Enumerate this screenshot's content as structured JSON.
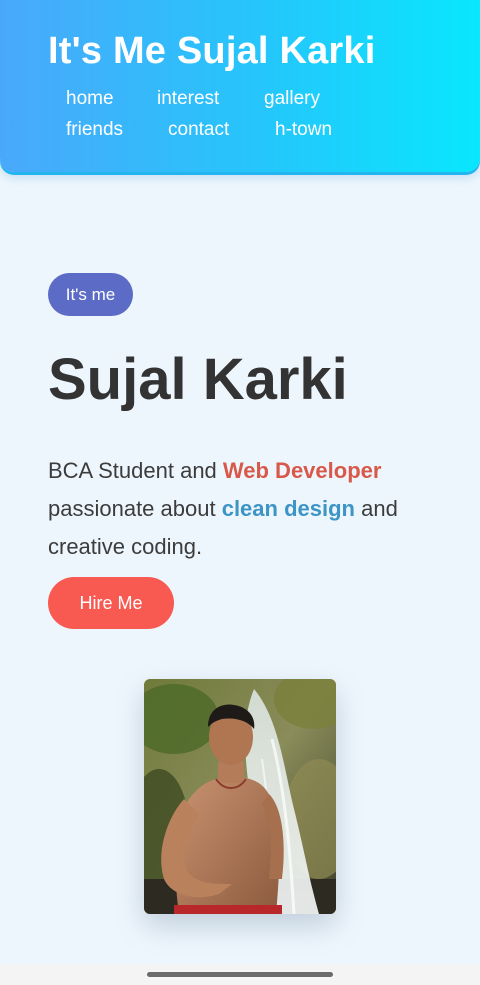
{
  "header": {
    "title": "It's Me Sujal Karki",
    "nav": [
      {
        "label": "home"
      },
      {
        "label": "interest"
      },
      {
        "label": "gallery"
      },
      {
        "label": "friends"
      },
      {
        "label": "contact"
      },
      {
        "label": "h-town"
      }
    ]
  },
  "hero": {
    "badge": "It's me",
    "name": "Sujal Karki",
    "intro": {
      "part1": "BCA Student and ",
      "highlight1": "Web Developer",
      "part2": " passionate about ",
      "highlight2": "clean design",
      "part3": " and creative coding."
    },
    "button_label": "Hire Me"
  },
  "photo": {
    "alt": "Portrait of Sujal Karki in front of a waterfall"
  },
  "colors": {
    "header_gradient_start": "#4aa8fb",
    "header_gradient_end": "#08e7fd",
    "badge": "#5b6bc6",
    "accent_red": "#d8584a",
    "accent_blue": "#3d95c6",
    "button": "#f85a52",
    "background": "#eef6fd"
  }
}
